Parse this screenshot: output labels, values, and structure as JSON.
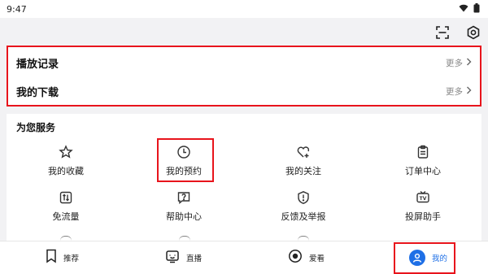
{
  "status_bar": {
    "time": "9:47",
    "icons": [
      "wifi-icon",
      "battery-icon"
    ]
  },
  "top_actions": {
    "icons": [
      "scan-icon",
      "settings-icon"
    ]
  },
  "history": {
    "rows": [
      {
        "title": "播放记录",
        "more": "更多"
      },
      {
        "title": "我的下载",
        "more": "更多"
      }
    ]
  },
  "services": {
    "title": "为您服务",
    "items": [
      {
        "label": "我的收藏",
        "icon": "star-icon"
      },
      {
        "label": "我的预约",
        "icon": "clock-icon"
      },
      {
        "label": "我的关注",
        "icon": "heart-plus-icon"
      },
      {
        "label": "订单中心",
        "icon": "clipboard-icon"
      },
      {
        "label": "免流量",
        "icon": "traffic-icon"
      },
      {
        "label": "帮助中心",
        "icon": "question-icon"
      },
      {
        "label": "反馈及举报",
        "icon": "shield-alert-icon"
      },
      {
        "label": "投屏助手",
        "icon": "tv-icon"
      }
    ]
  },
  "bottom_nav": {
    "items": [
      {
        "label": "推荐",
        "icon": "bookmark-icon"
      },
      {
        "label": "直播",
        "icon": "live-tv-icon"
      },
      {
        "label": "爱看",
        "icon": "record-icon"
      },
      {
        "label": "我的",
        "icon": "user-icon"
      }
    ],
    "active_color": "#1e6fe6"
  },
  "colors": {
    "highlight": "#e8141c",
    "accent": "#1e6fe6"
  }
}
